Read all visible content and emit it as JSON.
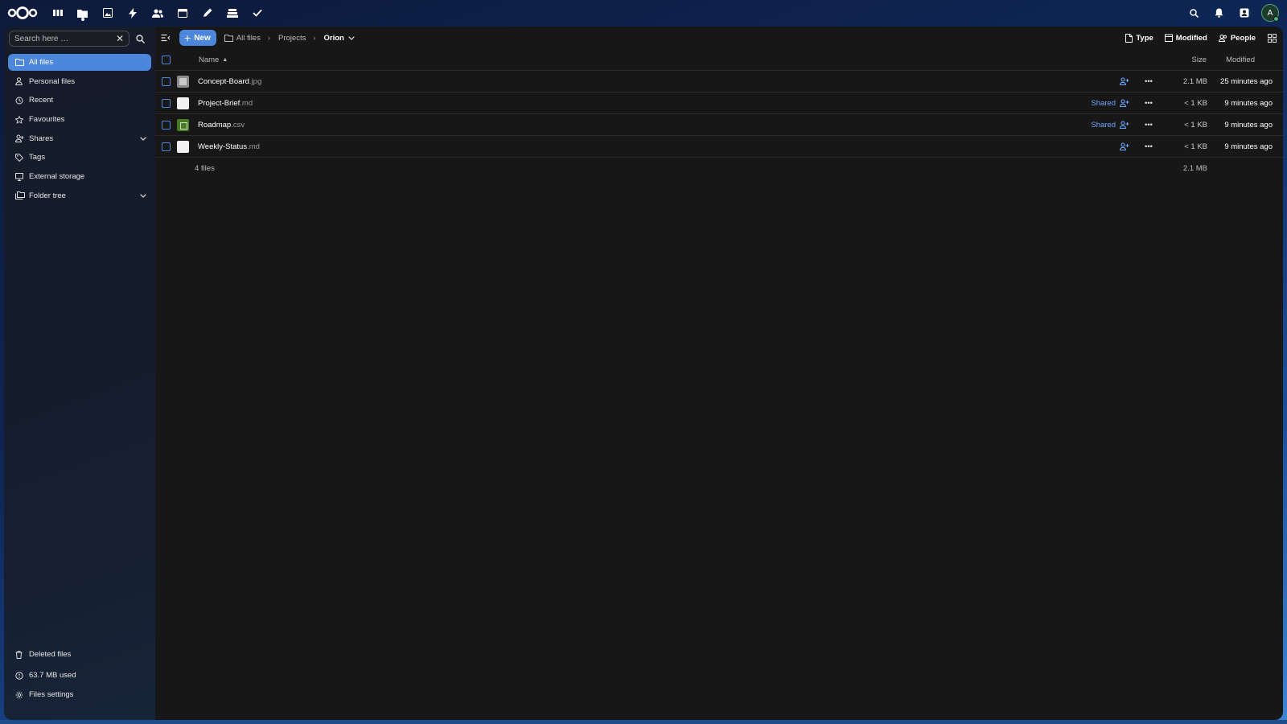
{
  "topbar": {
    "apps": [
      {
        "name": "dashboard-app-icon"
      },
      {
        "name": "files-app-icon",
        "active": true
      },
      {
        "name": "photos-app-icon"
      },
      {
        "name": "activity-app-icon"
      },
      {
        "name": "contacts-app-icon"
      },
      {
        "name": "calendar-app-icon"
      },
      {
        "name": "notes-app-icon"
      },
      {
        "name": "deck-app-icon"
      },
      {
        "name": "tasks-app-icon"
      }
    ],
    "avatar_initial": "A"
  },
  "sidebar": {
    "search_placeholder": "Search here …",
    "items": [
      {
        "label": "All files",
        "icon": "folder-icon",
        "active": true
      },
      {
        "label": "Personal files",
        "icon": "person-icon"
      },
      {
        "label": "Recent",
        "icon": "history-icon"
      },
      {
        "label": "Favourites",
        "icon": "star-icon"
      },
      {
        "label": "Shares",
        "icon": "share-icon",
        "expandable": true
      },
      {
        "label": "Tags",
        "icon": "tag-icon"
      },
      {
        "label": "External storage",
        "icon": "monitor-icon"
      },
      {
        "label": "Folder tree",
        "icon": "folder-tree-icon",
        "expandable": true
      }
    ],
    "bottom": [
      {
        "label": "Deleted files",
        "icon": "trash-icon"
      },
      {
        "label": "63.7 MB used",
        "icon": "storage-icon"
      },
      {
        "label": "Files settings",
        "icon": "gear-icon"
      }
    ]
  },
  "toolbar": {
    "new_label": "New",
    "breadcrumbs": [
      "All files",
      "Projects",
      "Orion"
    ],
    "filters": [
      "Type",
      "Modified",
      "People"
    ]
  },
  "table": {
    "headers": {
      "name": "Name",
      "size": "Size",
      "modified": "Modified"
    },
    "rows": [
      {
        "base": "Concept-Board",
        "ext": ".jpg",
        "thumb": "img",
        "shared": "",
        "size": "2.1 MB",
        "modified": "25 minutes ago"
      },
      {
        "base": "Project-Brief",
        "ext": ".md",
        "thumb": "doc",
        "shared": "Shared",
        "size": "< 1 KB",
        "modified": "9 minutes ago"
      },
      {
        "base": "Roadmap",
        "ext": ".csv",
        "thumb": "sheet",
        "shared": "Shared",
        "size": "< 1 KB",
        "modified": "9 minutes ago"
      },
      {
        "base": "Weekly-Status",
        "ext": ".md",
        "thumb": "doc",
        "shared": "",
        "size": "< 1 KB",
        "modified": "9 minutes ago"
      }
    ],
    "summary": {
      "count": "4 files",
      "total": "2.1 MB"
    }
  },
  "colors": {
    "accent": "#4d87db",
    "shared": "#6aa6ff",
    "background": "#171717"
  }
}
